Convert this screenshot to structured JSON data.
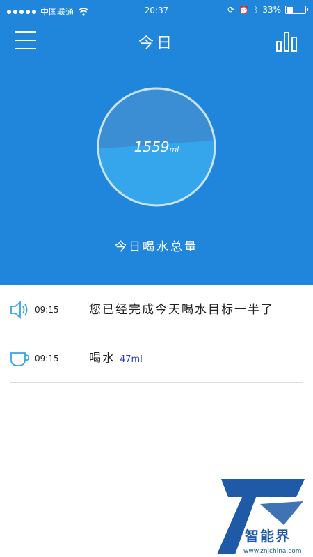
{
  "status_bar": {
    "carrier": "中国联通",
    "time": "20:37",
    "battery_percent": "33%"
  },
  "header": {
    "title": "今日"
  },
  "summary": {
    "total_value": "1559",
    "total_unit": "ml",
    "label": "今日喝水总量",
    "fill_fraction": 0.52
  },
  "log": [
    {
      "time": "09:15",
      "icon": "speaker-icon",
      "message": "您已经完成今天喝水目标一半了"
    },
    {
      "time": "09:15",
      "icon": "cup-icon",
      "message": "喝水",
      "amount": "47ml"
    }
  ],
  "watermark": {
    "brand": "智能界",
    "url": "www.znjchina.com"
  },
  "colors": {
    "header_bg": "#1f86dc",
    "water": "#35a6ec",
    "amount_text": "#2a3bd0"
  }
}
